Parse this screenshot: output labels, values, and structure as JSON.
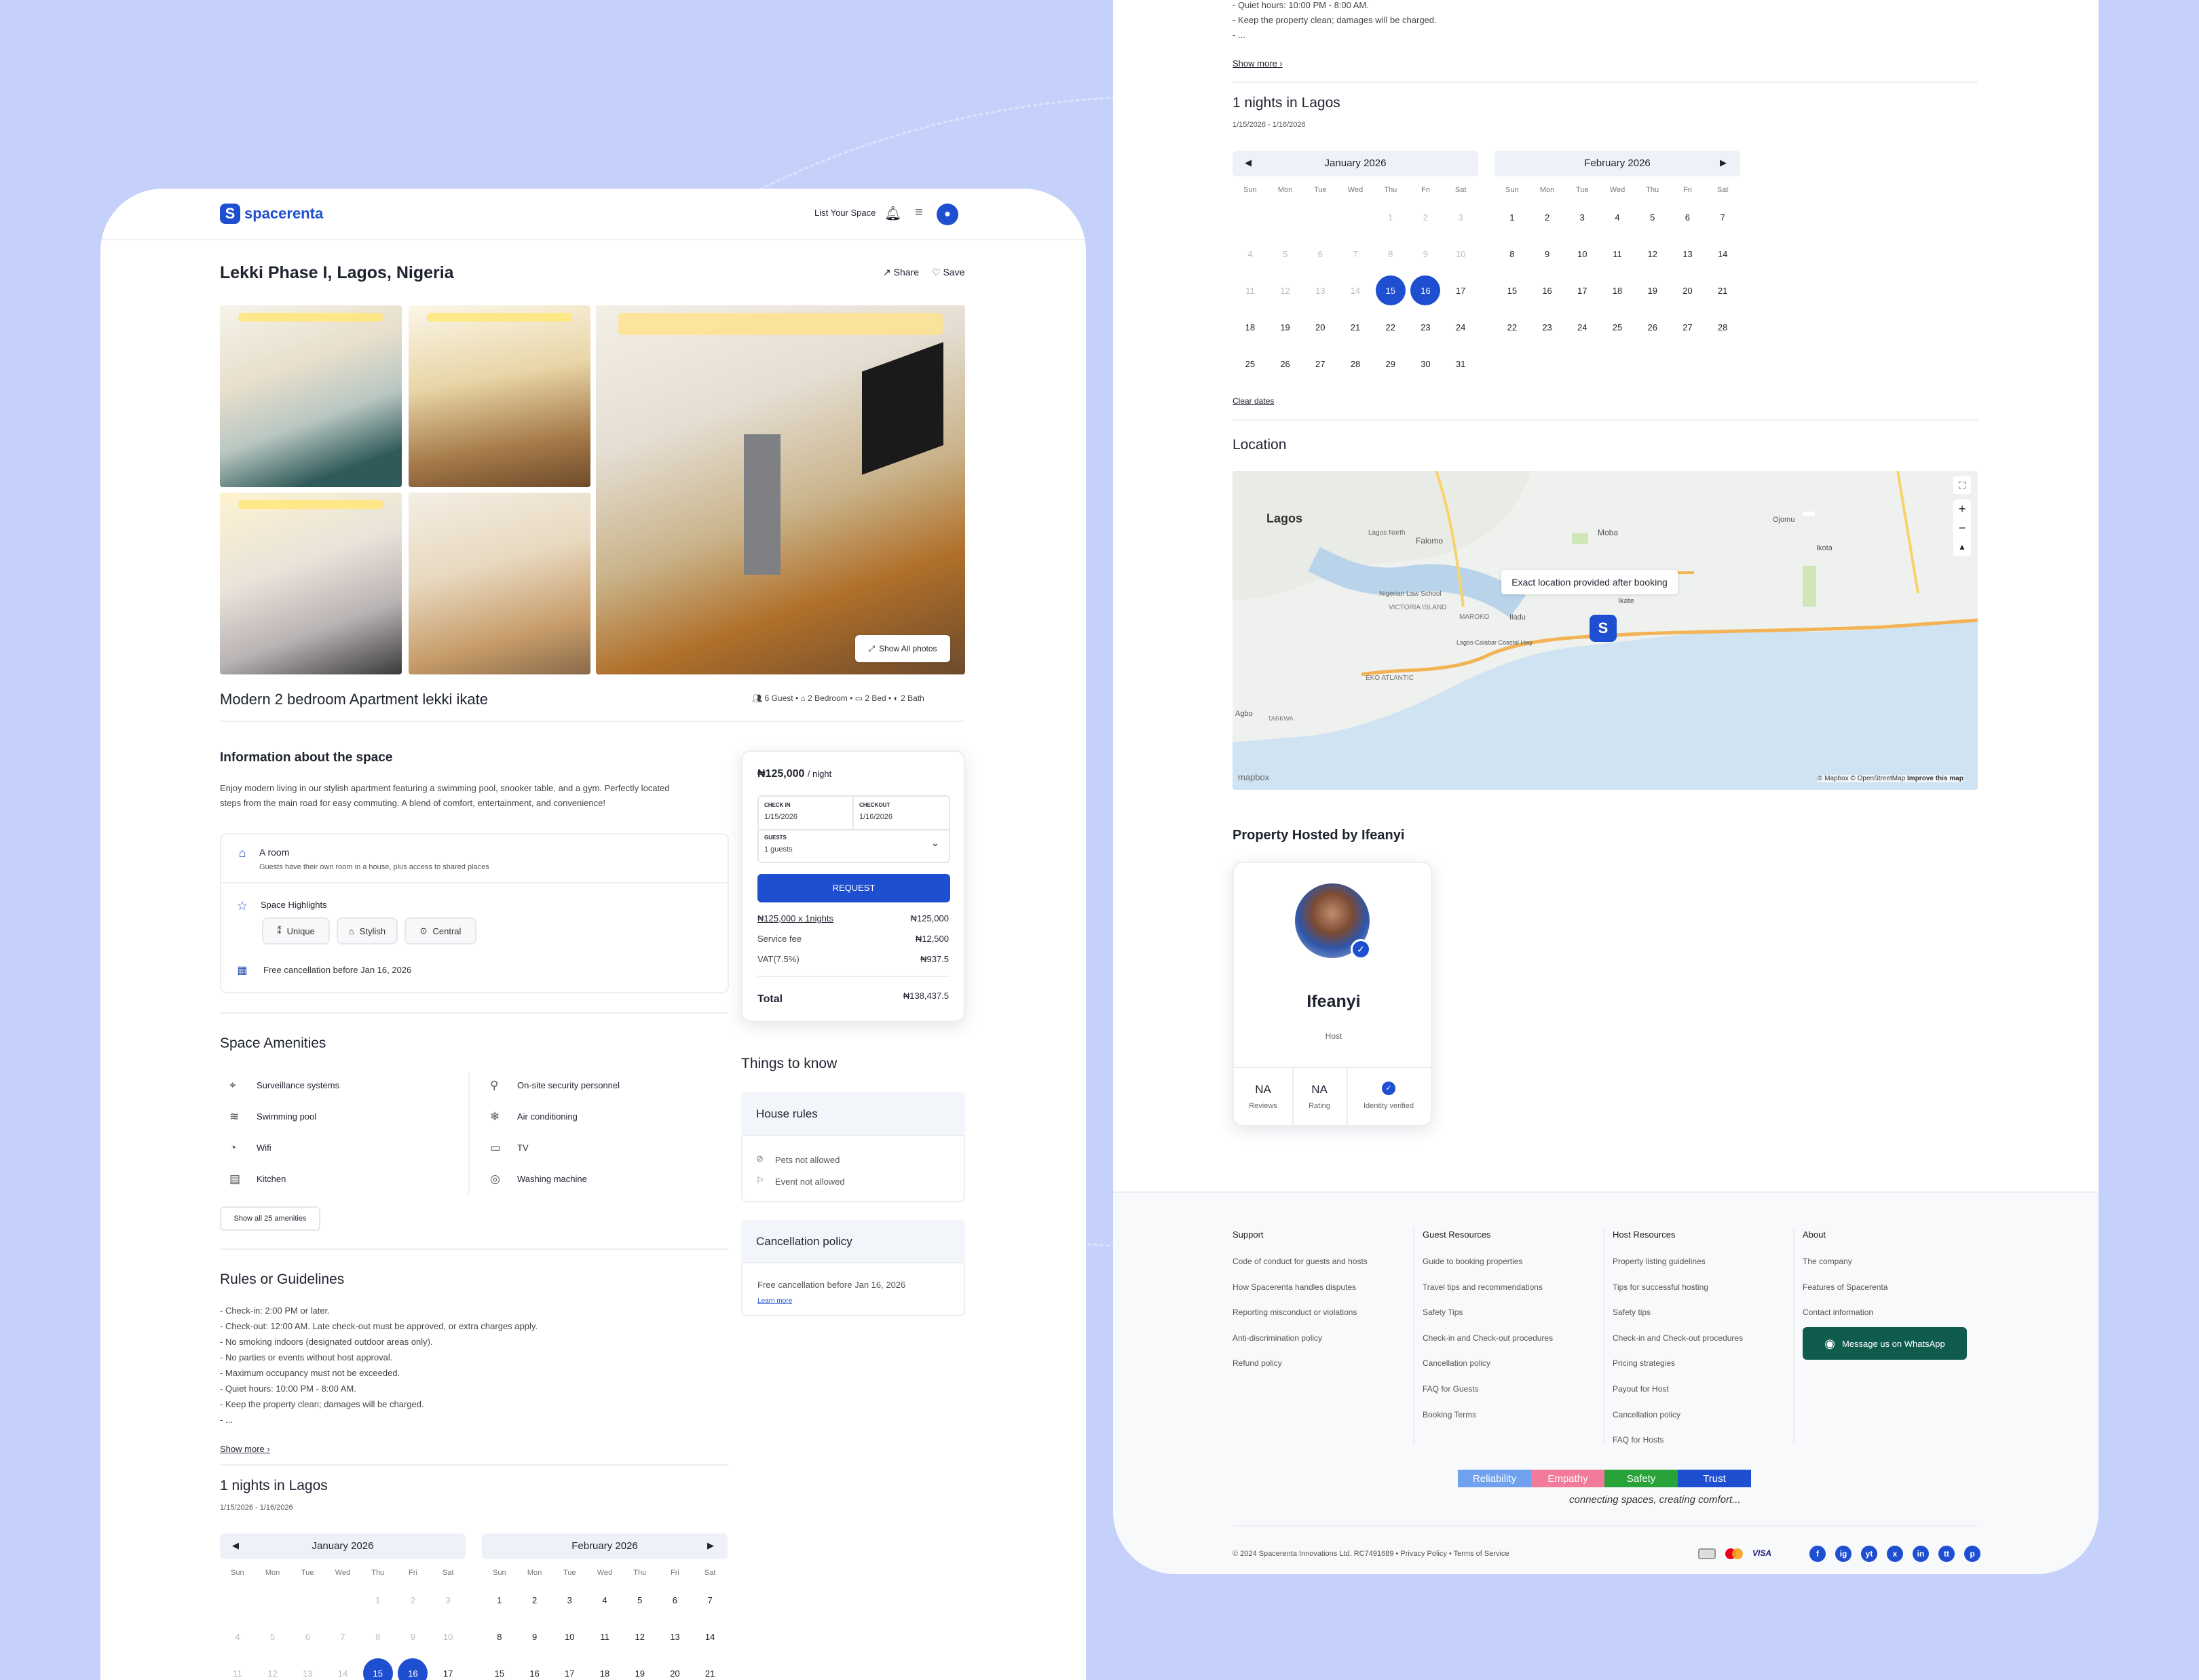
{
  "brand": {
    "name": "spacerenta",
    "mark": "S"
  },
  "header": {
    "list_space": "List Your Space"
  },
  "listing": {
    "location": "Lekki Phase I, Lagos, Nigeria",
    "share": "Share",
    "save": "Save",
    "show_photos": "Show All photos",
    "title": "Modern 2 bedroom Apartment lekki ikate",
    "stats": {
      "guests": "6 Guest",
      "bedrooms": "2 Bedroom",
      "beds": "2 Bed",
      "baths": "2 Bath"
    },
    "info_heading": "Information about the space",
    "description_l1": "Enjoy modern living in our stylish apartment featuring a swimming pool, snooker table, and a gym. Perfectly located",
    "description_l2": "steps from the main road for easy commuting. A blend of comfort, entertainment, and convenience!",
    "room_title": "A room",
    "room_sub": "Guests have their own room in a house, plus access to shared places",
    "highlights_title": "Space Highlights",
    "highlights": [
      "Unique",
      "Stylish",
      "Central"
    ],
    "cancellation": "Free cancellation before Jan 16, 2026"
  },
  "booking": {
    "price": "₦125,000",
    "per_night": "/ night",
    "checkin_label": "CHECK IN",
    "checkin": "1/15/2026",
    "checkout_label": "CHECKOUT",
    "checkout": "1/16/2026",
    "guests_label": "GUESTS",
    "guests": "1 guests",
    "request": "REQUEST",
    "line1_label": "₦125,000 x 1nights",
    "line1_value": "₦125,000",
    "fee_label": "Service fee",
    "fee_value": "₦12,500",
    "vat_label": "VAT(7.5%)",
    "vat_value": "₦937.5",
    "total_label": "Total",
    "total_value": "₦138,437.5"
  },
  "amenities": {
    "heading": "Space Amenities",
    "left": [
      "Surveillance systems",
      "Swimming pool",
      "Wifi",
      "Kitchen"
    ],
    "right": [
      "On-site security personnel",
      "Air conditioning",
      "TV",
      "Washing machine"
    ],
    "show_all": "Show all 25 amenities"
  },
  "things": {
    "heading": "Things to know",
    "house_rules": "House rules",
    "pets": "Pets not allowed",
    "events": "Event not allowed",
    "cancel_heading": "Cancellation policy",
    "cancel_text": "Free cancellation before Jan 16, 2026",
    "learn_more": "Learn more"
  },
  "rules": {
    "heading": "Rules or Guidelines",
    "items": [
      "- Check-in: 2:00 PM or later.",
      "- Check-out: 12:00 AM. Late check-out must be approved, or extra charges apply.",
      "- No smoking indoors (designated outdoor areas only).",
      "- No parties or events without host approval.",
      "- Maximum occupancy must not be exceeded.",
      "- Quiet hours: 10:00 PM - 8:00 AM.",
      "- Keep the property clean; damages will be charged.",
      "- ..."
    ],
    "show_more": "Show more"
  },
  "stay": {
    "heading": "1 nights in Lagos",
    "range": "1/15/2026 - 1/16/2026",
    "clear": "Clear dates"
  },
  "calendar": {
    "weekdays": [
      "Sun",
      "Mon",
      "Tue",
      "Wed",
      "Thu",
      "Fri",
      "Sat"
    ],
    "months": [
      {
        "name": "January 2026",
        "offset": 4,
        "days": 31,
        "past_until": 14,
        "selected": [
          15,
          16
        ]
      },
      {
        "name": "February 2026",
        "offset": 0,
        "days": 28,
        "past_until": 0,
        "selected": []
      }
    ]
  },
  "location": {
    "heading": "Location",
    "tooltip": "Exact location provided after booking",
    "labels": {
      "lagos": "Lagos",
      "lagos_north": "Lagos North",
      "falomo": "Falomo",
      "moba": "Moba",
      "ojomu": "Ojomu",
      "ikate": "Ikate",
      "ikota": "Ikota",
      "victoria_island": "VICTORIA ISLAND",
      "nigerian_law_school": "Nigerian Law School",
      "iladu": "Iladu",
      "maroko": "MAROKO",
      "eko_atlantic": "EKO ATLANTIC",
      "agbo": "Agbo",
      "tarkwa": "TARKWA",
      "coastal_hwy": "Lagos-Calabar Coastal Hwy"
    },
    "mapbox": "mapbox",
    "attribution": "© Mapbox © OpenStreetMap",
    "improve": "Improve this map"
  },
  "host": {
    "heading": "Property Hosted by Ifeanyi",
    "name": "Ifeanyi",
    "role": "Host",
    "reviews_value": "NA",
    "reviews_label": "Reviews",
    "rating_value": "NA",
    "rating_label": "Rating",
    "verified_label": "Identity verified"
  },
  "footer": {
    "support": {
      "title": "Support",
      "items": [
        "Code of conduct for guests and hosts",
        "How Spacerenta handles disputes",
        "Reporting misconduct or violations",
        "Anti-discrimination policy",
        "Refund policy"
      ]
    },
    "guest": {
      "title": "Guest Resources",
      "items": [
        "Guide to booking properties",
        "Travel tips and recommendations",
        "Safety Tips",
        "Check-in and Check-out procedures",
        "Cancellation policy",
        "FAQ for Guests",
        "Booking Terms"
      ]
    },
    "hostres": {
      "title": "Host Resources",
      "items": [
        "Property listing guidelines",
        "Tips for successful hosting",
        "Safety tips",
        "Check-in and Check-out procedures",
        "Pricing strategies",
        "Payout for Host",
        "Cancellation policy",
        "FAQ for Hosts"
      ]
    },
    "about": {
      "title": "About",
      "items": [
        "The company",
        "Features of Spacerenta",
        "Contact information"
      ]
    },
    "whatsapp": "Message us on WhatsApp",
    "values": [
      "Reliability",
      "Empathy",
      "Safety",
      "Trust"
    ],
    "value_colors": [
      "#6fa1ee",
      "#f27a9a",
      "#27a33a",
      "#1f4fd1"
    ],
    "tagline": "connecting spaces, creating comfort...",
    "copyright": "© 2024 Spacerenta Innovations Ltd. RC7491689",
    "privacy": "Privacy Policy",
    "terms": "Terms of Service",
    "cards": [
      "VISA"
    ],
    "social": [
      "f",
      "ig",
      "yt",
      "x",
      "in",
      "tt",
      "p"
    ]
  },
  "colors": {
    "primary": "#1f4fd1",
    "whatsapp": "#0f5c4f",
    "bg": "#c5d1fb"
  }
}
